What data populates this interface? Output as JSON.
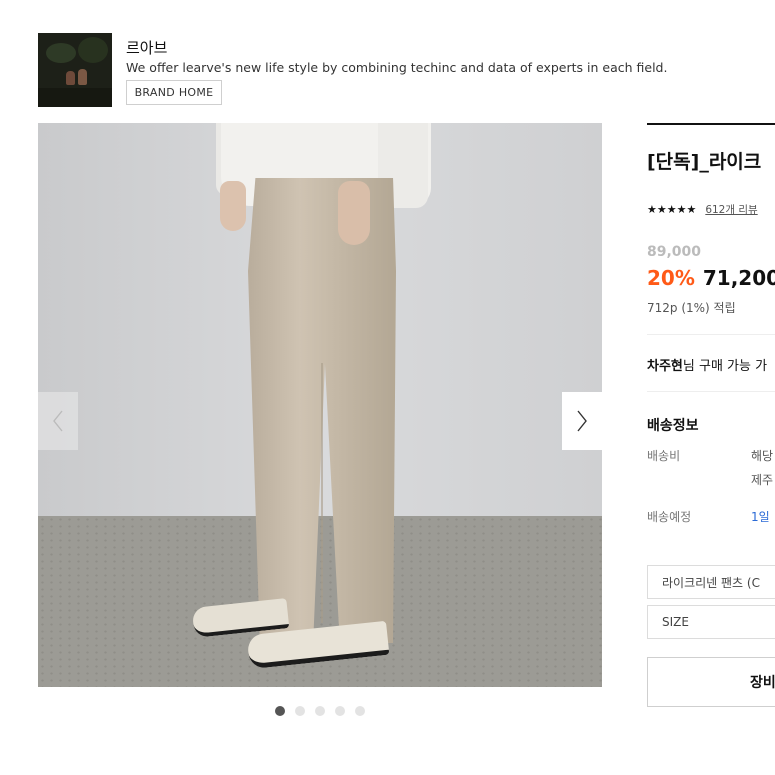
{
  "brand": {
    "name": "르아브",
    "description": "We offer learve's new life style by combining techinc and data of experts in each field.",
    "home_button": "BRAND HOME"
  },
  "gallery": {
    "slide_count": 5,
    "active_slide": 1,
    "prev_arrow": "‹",
    "next_arrow": "›"
  },
  "product": {
    "title": "[단독]_라이크",
    "stars": "★★★★★",
    "review_count": "612개 리뷰",
    "original_price": "89,000",
    "discount": "20%",
    "sale_price": "71,200",
    "points": "712p (1%) 적립",
    "purchase_notice_name": "차주현",
    "purchase_notice_rest": "님 구매 가능 가"
  },
  "shipping": {
    "title": "배송정보",
    "fee_label": "배송비",
    "fee_value_1": "해당",
    "fee_value_2": "제주",
    "eta_label": "배송예정",
    "eta_value": "1일"
  },
  "options": {
    "color_select": "라이크리넨 팬츠 (C",
    "size_select": "SIZE"
  },
  "actions": {
    "cart_label": "장비"
  },
  "colors": {
    "discount": "#ff5a17",
    "eta_link": "#2b6ad6"
  }
}
